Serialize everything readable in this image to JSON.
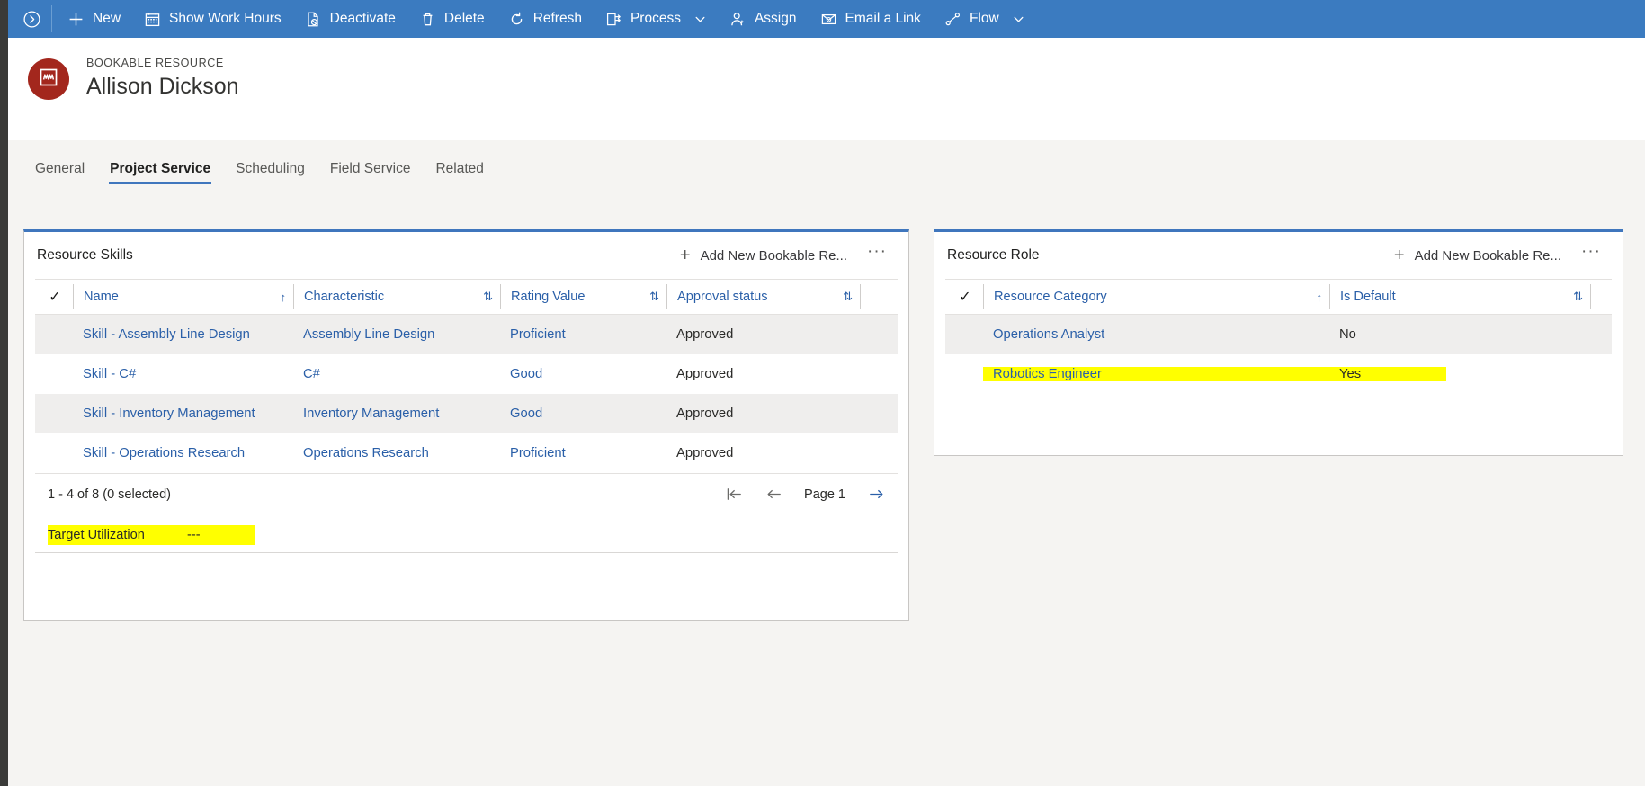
{
  "commandbar": {
    "expand_icon": "chevron-circle-right-icon",
    "buttons": [
      {
        "label": "New",
        "icon": "plus-icon",
        "chevron": false
      },
      {
        "label": "Show Work Hours",
        "icon": "calendar-icon",
        "chevron": false
      },
      {
        "label": "Deactivate",
        "icon": "page-block-icon",
        "chevron": false
      },
      {
        "label": "Delete",
        "icon": "trash-icon",
        "chevron": false
      },
      {
        "label": "Refresh",
        "icon": "refresh-icon",
        "chevron": false
      },
      {
        "label": "Process",
        "icon": "process-icon",
        "chevron": true
      },
      {
        "label": "Assign",
        "icon": "person-icon",
        "chevron": false
      },
      {
        "label": "Email a Link",
        "icon": "email-link-icon",
        "chevron": false
      },
      {
        "label": "Flow",
        "icon": "flow-icon",
        "chevron": true
      }
    ]
  },
  "record": {
    "entity_label": "BOOKABLE RESOURCE",
    "title": "Allison Dickson",
    "avatar_icon": "bookable-resource-icon",
    "avatar_color": "#a3271d"
  },
  "tabs": [
    {
      "label": "General",
      "active": false
    },
    {
      "label": "Project Service",
      "active": true
    },
    {
      "label": "Scheduling",
      "active": false
    },
    {
      "label": "Field Service",
      "active": false
    },
    {
      "label": "Related",
      "active": false
    }
  ],
  "theme": {
    "command_bar_blue": "#3b7bc0",
    "accent_blue": "#3f76bd",
    "link_blue": "#2a5fa8",
    "highlight_yellow": "#ffff00",
    "page_background": "#f5f4f2"
  },
  "skills_panel": {
    "title": "Resource Skills",
    "add_label": "Add New Bookable Re...",
    "more_label": "···",
    "columns": [
      {
        "label": "Name",
        "sort": "↑"
      },
      {
        "label": "Characteristic",
        "sort": "⇅"
      },
      {
        "label": "Rating Value",
        "sort": "⇅"
      },
      {
        "label": "Approval status",
        "sort": "⇅"
      }
    ],
    "rows": [
      {
        "name": "Skill - Assembly Line Design",
        "characteristic": "Assembly Line Design",
        "rating": "Proficient",
        "approval": "Approved"
      },
      {
        "name": "Skill - C#",
        "characteristic": "C#",
        "rating": "Good",
        "approval": "Approved"
      },
      {
        "name": "Skill - Inventory Management",
        "characteristic": "Inventory Management",
        "rating": "Good",
        "approval": "Approved"
      },
      {
        "name": "Skill - Operations Research",
        "characteristic": "Operations Research",
        "rating": "Proficient",
        "approval": "Approved"
      }
    ],
    "pager": {
      "count_text": "1 - 4 of 8 (0 selected)",
      "page_label": "Page 1",
      "first_icon": "first-page-icon",
      "prev_icon": "previous-page-icon",
      "next_icon": "next-page-icon"
    },
    "field": {
      "label": "Target Utilization",
      "value": "---",
      "highlighted": true
    }
  },
  "role_panel": {
    "title": "Resource Role",
    "add_label": "Add New Bookable Re...",
    "more_label": "···",
    "columns": [
      {
        "label": "Resource Category",
        "sort": "↑"
      },
      {
        "label": "Is Default",
        "sort": "⇅"
      }
    ],
    "rows": [
      {
        "category": "Operations Analyst",
        "is_default": "No",
        "highlighted": false
      },
      {
        "category": "Robotics Engineer",
        "is_default": "Yes",
        "highlighted": true
      }
    ]
  },
  "select_all_icon": "✓"
}
